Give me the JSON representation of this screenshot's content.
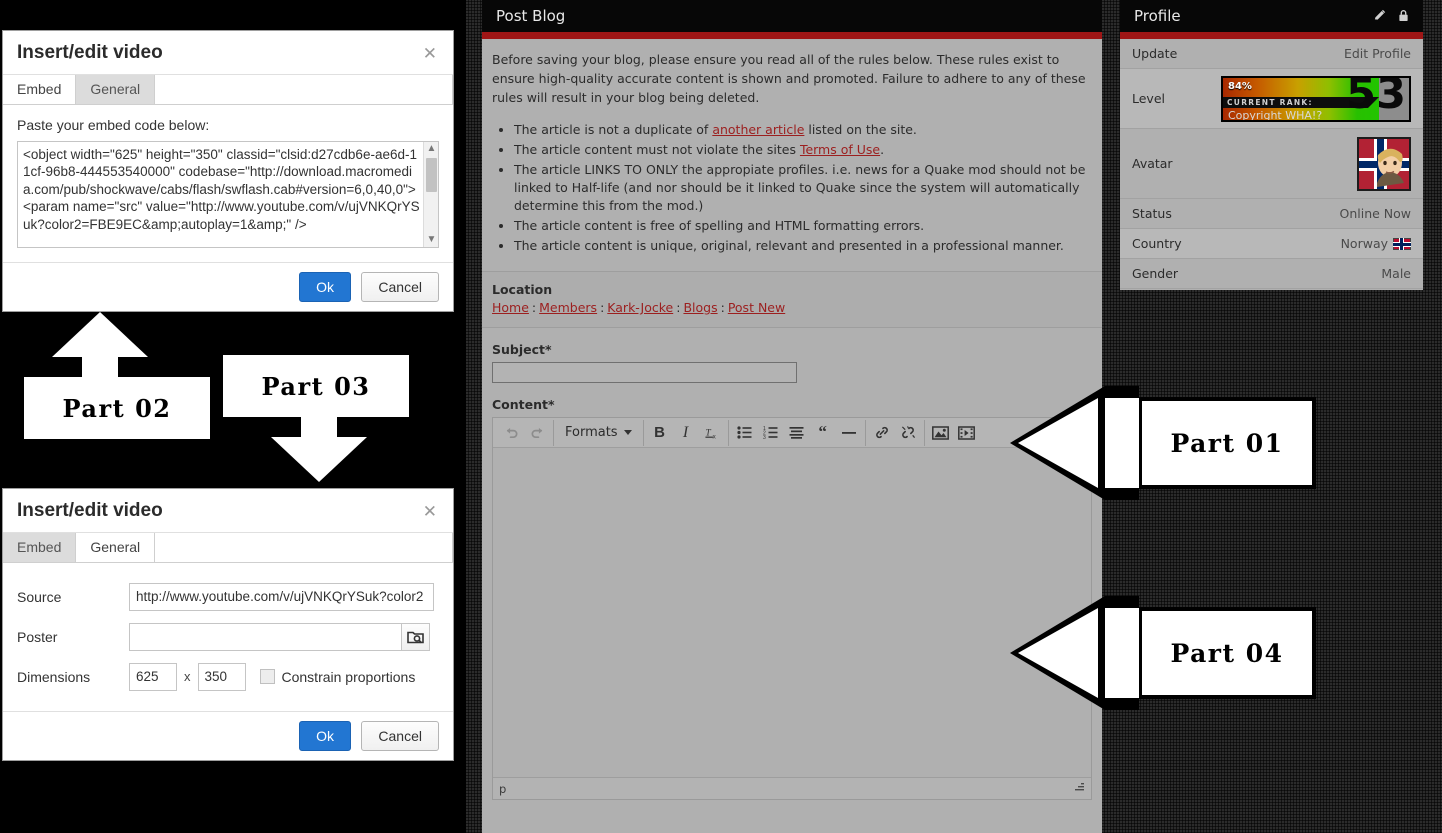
{
  "dialog_embed": {
    "title": "Insert/edit video",
    "close_icon": "close-icon",
    "tabs": [
      {
        "label": "Embed",
        "active": true
      },
      {
        "label": "General",
        "active": false
      }
    ],
    "embed_label": "Paste your embed code below:",
    "embed_code": "<object width=\"625\" height=\"350\" classid=\"clsid:d27cdb6e-ae6d-11cf-96b8-444553540000\" codebase=\"http://download.macromedia.com/pub/shockwave/cabs/flash/swflash.cab#version=6,0,40,0\">\n<param name=\"src\" value=\"http://www.youtube.com/v/ujVNKQrYSuk?color2=FBE9EC&amp;autoplay=1&amp;\" />",
    "ok_label": "Ok",
    "cancel_label": "Cancel"
  },
  "dialog_general": {
    "title": "Insert/edit video",
    "close_icon": "close-icon",
    "tabs": [
      {
        "label": "Embed",
        "active": false
      },
      {
        "label": "General",
        "active": true
      }
    ],
    "fields": {
      "source_label": "Source",
      "source_value": "http://www.youtube.com/v/ujVNKQrYSuk?color2",
      "poster_label": "Poster",
      "poster_value": "",
      "poster_placeholder": "",
      "browse_icon": "browse-folder-icon",
      "dimensions_label": "Dimensions",
      "width_value": "625",
      "separator": "x",
      "height_value": "350",
      "constrain_label": "Constrain proportions",
      "constrain_checked": false
    },
    "ok_label": "Ok",
    "cancel_label": "Cancel"
  },
  "annotations": [
    {
      "id": "part-01",
      "label": "Part 01",
      "direction": "left"
    },
    {
      "id": "part-02",
      "label": "Part 02",
      "direction": "up"
    },
    {
      "id": "part-03",
      "label": "Part 03",
      "direction": "down"
    },
    {
      "id": "part-04",
      "label": "Part 04",
      "direction": "left"
    }
  ],
  "post_blog": {
    "header_title": "Post Blog",
    "intro": "Before saving your blog, please ensure you read all of the rules below. These rules exist to ensure high-quality accurate content is shown and promoted. Failure to adhere to any of these rules will result in your blog being deleted.",
    "rules": [
      {
        "pre": "The article is not a duplicate of ",
        "link": "another article",
        "post": " listed on the site."
      },
      {
        "pre": "The article content must not violate the sites ",
        "link": "Terms of Use",
        "post": "."
      },
      {
        "pre": "The article LINKS TO ONLY the appropiate profiles. i.e. news for a Quake mod should not be linked to Half-life (and nor should be it linked to Quake since the system will automatically determine this from the mod.)",
        "link": "",
        "post": ""
      },
      {
        "pre": "The article content is free of spelling and HTML formatting errors.",
        "link": "",
        "post": ""
      },
      {
        "pre": "The article content is unique, original, relevant and presented in a professional manner.",
        "link": "",
        "post": ""
      }
    ],
    "location_label": "Location",
    "breadcrumbs": [
      "Home",
      "Members",
      "Kark-Jocke",
      "Blogs",
      "Post New"
    ],
    "breadcrumb_separator": ":",
    "subject_label": "Subject*",
    "subject_value": "",
    "content_label": "Content*",
    "editor": {
      "toolbar": [
        {
          "name": "undo-icon",
          "glyph": "↶",
          "disabled": true
        },
        {
          "name": "redo-icon",
          "glyph": "↷",
          "disabled": true
        },
        {
          "name": "formats-dropdown",
          "glyph": "Formats",
          "disabled": false
        },
        {
          "name": "bold-icon",
          "glyph": "B",
          "disabled": false
        },
        {
          "name": "italic-icon",
          "glyph": "I",
          "disabled": false
        },
        {
          "name": "remove-format-icon",
          "glyph": "Tx",
          "disabled": false
        },
        {
          "name": "bullet-list-icon",
          "glyph": "☰",
          "disabled": false
        },
        {
          "name": "numbered-list-icon",
          "glyph": "☰",
          "disabled": false
        },
        {
          "name": "align-icon",
          "glyph": "≡",
          "disabled": false
        },
        {
          "name": "blockquote-icon",
          "glyph": "“",
          "disabled": false
        },
        {
          "name": "horizontal-rule-icon",
          "glyph": "—",
          "disabled": false
        },
        {
          "name": "link-icon",
          "glyph": "⚭",
          "disabled": false
        },
        {
          "name": "unlink-icon",
          "glyph": "⚭",
          "disabled": false
        },
        {
          "name": "image-icon",
          "glyph": "⛰",
          "disabled": false
        },
        {
          "name": "media-icon",
          "glyph": "▶",
          "disabled": false
        }
      ],
      "formats_label": "Formats",
      "content_value": "",
      "status_path": "p",
      "resize_icon": "resize-grip-icon"
    }
  },
  "profile": {
    "header_title": "Profile",
    "header_icons": [
      "edit-pencil-icon",
      "lock-icon"
    ],
    "rows": [
      {
        "key": "Update",
        "value": "Edit Profile",
        "type": "link"
      },
      {
        "key": "Level",
        "value": "",
        "type": "level"
      },
      {
        "key": "Avatar",
        "value": "",
        "type": "avatar"
      },
      {
        "key": "Status",
        "value": "Online Now",
        "type": "text"
      },
      {
        "key": "Country",
        "value": "Norway",
        "type": "country"
      },
      {
        "key": "Gender",
        "value": "Male",
        "type": "text"
      }
    ],
    "level": {
      "percent_label": "84%",
      "percent": 84,
      "rank_label": "CURRENT RANK:",
      "rank_name": "Copyright WHA!?",
      "level_number": "53"
    }
  },
  "colors": {
    "accent_red": "#9f1616",
    "primary_button": "#2276d2",
    "link_red": "#9c1f1f",
    "panel_bg": "#b0b0b0",
    "header_black": "#070707"
  }
}
